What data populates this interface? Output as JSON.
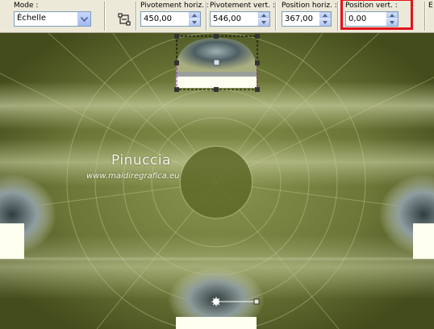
{
  "toolbar": {
    "mode": {
      "label": "Mode :",
      "value": "Échelle"
    },
    "pivot_h": {
      "label": "Pivotement horiz. :",
      "value": "450,00"
    },
    "pivot_v": {
      "label": "Pivotement vert. :",
      "value": "546,00"
    },
    "pos_h": {
      "label": "Position horiz. :",
      "value": "367,00"
    },
    "pos_v": {
      "label": "Position vert. :",
      "value": "0,00"
    },
    "edge_label": "E"
  },
  "watermark": {
    "name": "Pinuccia",
    "url": "www.maidiregrafica.eu"
  },
  "colors": {
    "highlight": "#e3141b",
    "canvas_dark": "#4a5320",
    "canvas_mid": "#7b8744",
    "canvas_light": "#c9cf9c"
  },
  "icons": {
    "tool": "pick-tool-icon",
    "dropdown": "chevron-down-icon",
    "spin_up": "arrow-up-icon",
    "spin_down": "arrow-down-icon"
  }
}
